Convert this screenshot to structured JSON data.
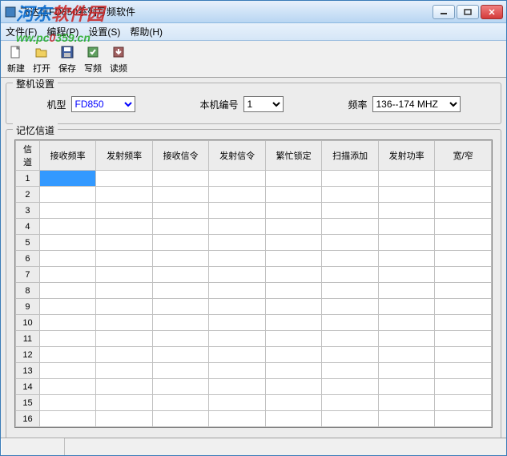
{
  "window": {
    "title": "飞达信FD850系列写频软件"
  },
  "menu": {
    "file": "文件(F)",
    "program": "编程(P)",
    "settings": "设置(S)",
    "help": "帮助(H)"
  },
  "toolbar": {
    "new": "新建",
    "open": "打开",
    "save": "保存",
    "write": "写频",
    "read": "读频"
  },
  "watermark": {
    "part1": "河东",
    "part3": " w",
    "part4": "软件园",
    "url_prefix": "w.pc",
    "url_mid": "0",
    "url_suffix": "359.cn"
  },
  "settings_group": {
    "legend": "整机设置",
    "model_label": "机型",
    "model_value": "FD850",
    "devno_label": "本机编号",
    "devno_value": "1",
    "freq_label": "频率",
    "freq_value": "136--174 MHZ"
  },
  "memory_group": {
    "legend": "记忆信道"
  },
  "table": {
    "headers": [
      "信道",
      "接收频率",
      "发射频率",
      "接收信令",
      "发射信令",
      "繁忙锁定",
      "扫描添加",
      "发射功率",
      "宽/窄"
    ],
    "rows": [
      "1",
      "2",
      "3",
      "4",
      "5",
      "6",
      "7",
      "8",
      "9",
      "10",
      "11",
      "12",
      "13",
      "14",
      "15",
      "16"
    ]
  }
}
